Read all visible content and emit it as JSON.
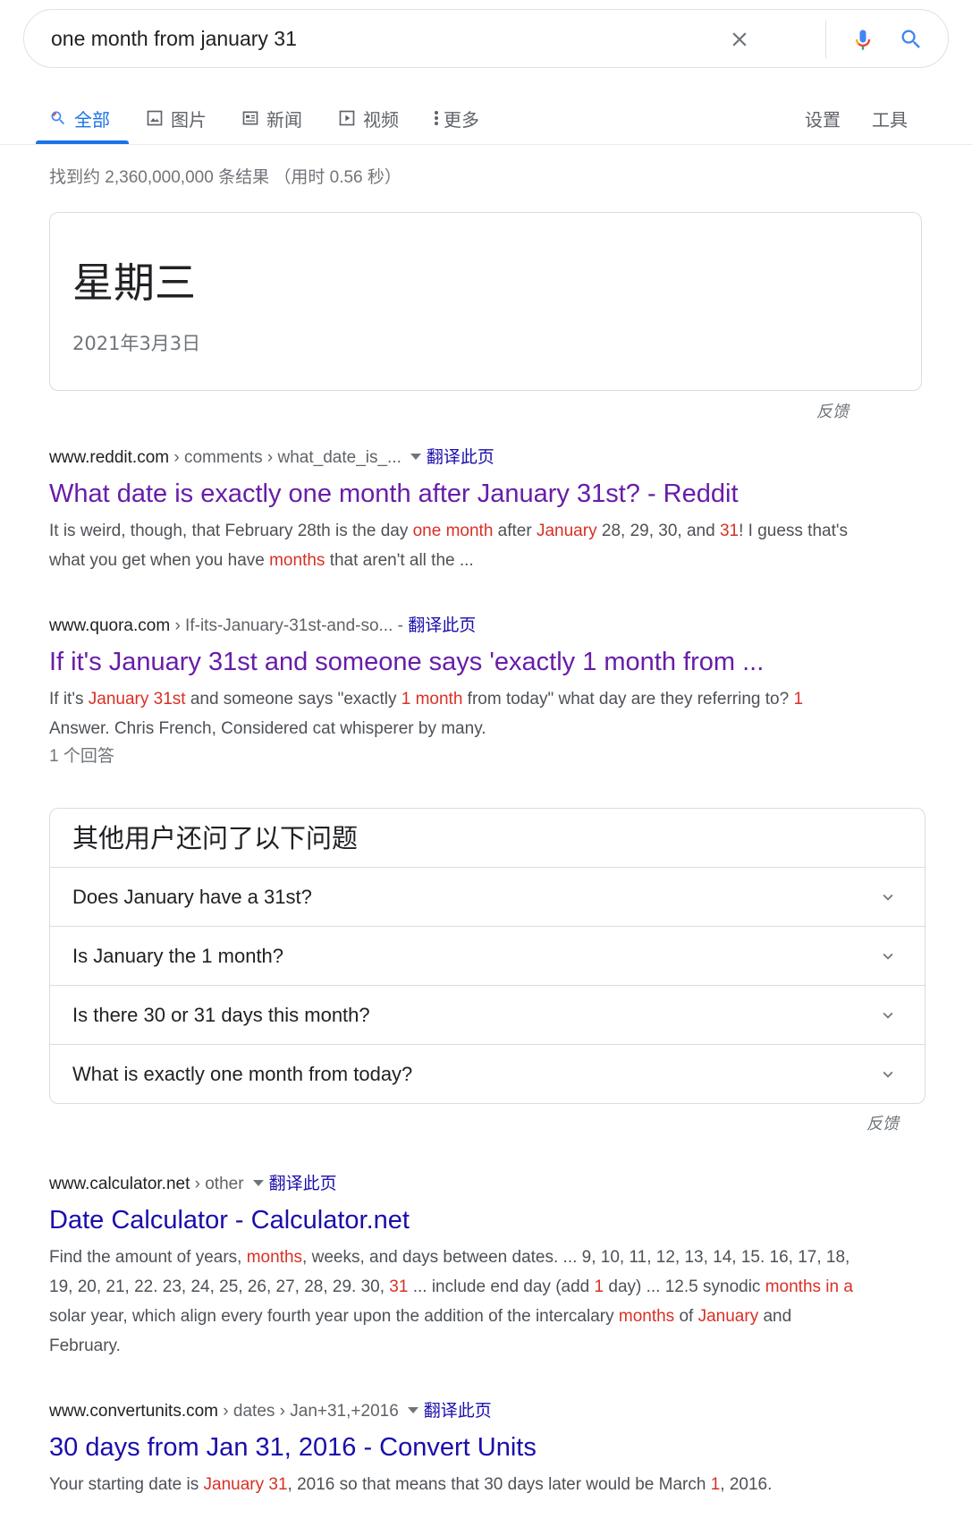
{
  "search": {
    "query": "one month from january 31"
  },
  "tabs": [
    {
      "label": "全部",
      "icon": "search-icon"
    },
    {
      "label": "图片",
      "icon": "image-icon"
    },
    {
      "label": "新闻",
      "icon": "newspaper-icon"
    },
    {
      "label": "视频",
      "icon": "video-icon"
    },
    {
      "label": "更多",
      "icon": "more-vert-icon"
    }
  ],
  "tools": {
    "settings": "设置",
    "tools": "工具"
  },
  "result_stats": "找到约 2,360,000,000 条结果 （用时 0.56 秒）",
  "answer": {
    "main": "星期三",
    "sub": "2021年3月3日",
    "feedback": "反馈"
  },
  "results": [
    {
      "domain": "www.reddit.com",
      "path": " › comments › what_date_is_...",
      "translate": "翻译此页",
      "title": "What date is exactly one month after January 31st? - Reddit",
      "snippet_parts": [
        {
          "t": "It is weird, though, that February 28th is the day ",
          "h": false
        },
        {
          "t": "one month",
          "h": true
        },
        {
          "t": " after ",
          "h": false
        },
        {
          "t": "January",
          "h": true
        },
        {
          "t": " 28, 29, 30, and ",
          "h": false
        },
        {
          "t": "31",
          "h": true
        },
        {
          "t": "! I guess that's what you get when you have ",
          "h": false
        },
        {
          "t": "months",
          "h": true
        },
        {
          "t": " that aren't all the ...",
          "h": false
        }
      ]
    },
    {
      "domain": "www.quora.com",
      "path": " › If-its-January-31st-and-so... - ",
      "translate": "翻译此页",
      "title": "If it's January 31st and someone says 'exactly 1 month from ...",
      "snippet_parts": [
        {
          "t": "If it's ",
          "h": false
        },
        {
          "t": "January 31st",
          "h": true
        },
        {
          "t": " and someone says \"exactly ",
          "h": false
        },
        {
          "t": "1 month",
          "h": true
        },
        {
          "t": " from today\" what day are they referring to? ",
          "h": false
        },
        {
          "t": "1",
          "h": true
        },
        {
          "t": " Answer. Chris French, Considered cat whisperer by many.",
          "h": false
        }
      ],
      "answer_count": "1 个回答"
    },
    {
      "domain": "www.calculator.net",
      "path": " › other",
      "translate": "翻译此页",
      "title": "Date Calculator - Calculator.net",
      "snippet_parts": [
        {
          "t": "Find the amount of years, ",
          "h": false
        },
        {
          "t": "months",
          "h": true
        },
        {
          "t": ", weeks, and days between dates. ... 9, 10, 11, 12, 13, 14, 15. 16, 17, 18, 19, 20, 21, 22. 23, 24, 25, 26, 27, 28, 29. 30, ",
          "h": false
        },
        {
          "t": "31",
          "h": true
        },
        {
          "t": " ... include end day (add ",
          "h": false
        },
        {
          "t": "1",
          "h": true
        },
        {
          "t": " day) ... 12.5 synodic ",
          "h": false
        },
        {
          "t": "months in a",
          "h": true
        },
        {
          "t": " solar year, which align every fourth year upon the addition of the intercalary ",
          "h": false
        },
        {
          "t": "months",
          "h": true
        },
        {
          "t": " of ",
          "h": false
        },
        {
          "t": "January",
          "h": true
        },
        {
          "t": " and February.",
          "h": false
        }
      ]
    },
    {
      "domain": "www.convertunits.com",
      "path": " › dates › Jan+31,+2016",
      "translate": "翻译此页",
      "title": "30 days from Jan 31, 2016 - Convert Units",
      "snippet_parts": [
        {
          "t": "Your starting date is ",
          "h": false
        },
        {
          "t": "January",
          "h": true
        },
        {
          "t": " ",
          "h": false
        },
        {
          "t": "31",
          "h": true
        },
        {
          "t": ", 2016 so that means that 30 days later would be March ",
          "h": false
        },
        {
          "t": "1",
          "h": true
        },
        {
          "t": ", 2016.",
          "h": false
        }
      ]
    }
  ],
  "paa": {
    "title": "其他用户还问了以下问题",
    "questions": [
      "Does January have a 31st?",
      "Is January the 1 month?",
      "Is there 30 or 31 days this month?",
      "What is exactly one month from today?"
    ],
    "feedback": "反馈"
  },
  "colors": {
    "link": "#1a0dab",
    "visited": "#681da8",
    "highlight": "#d93025",
    "accent": "#1a73e8"
  }
}
